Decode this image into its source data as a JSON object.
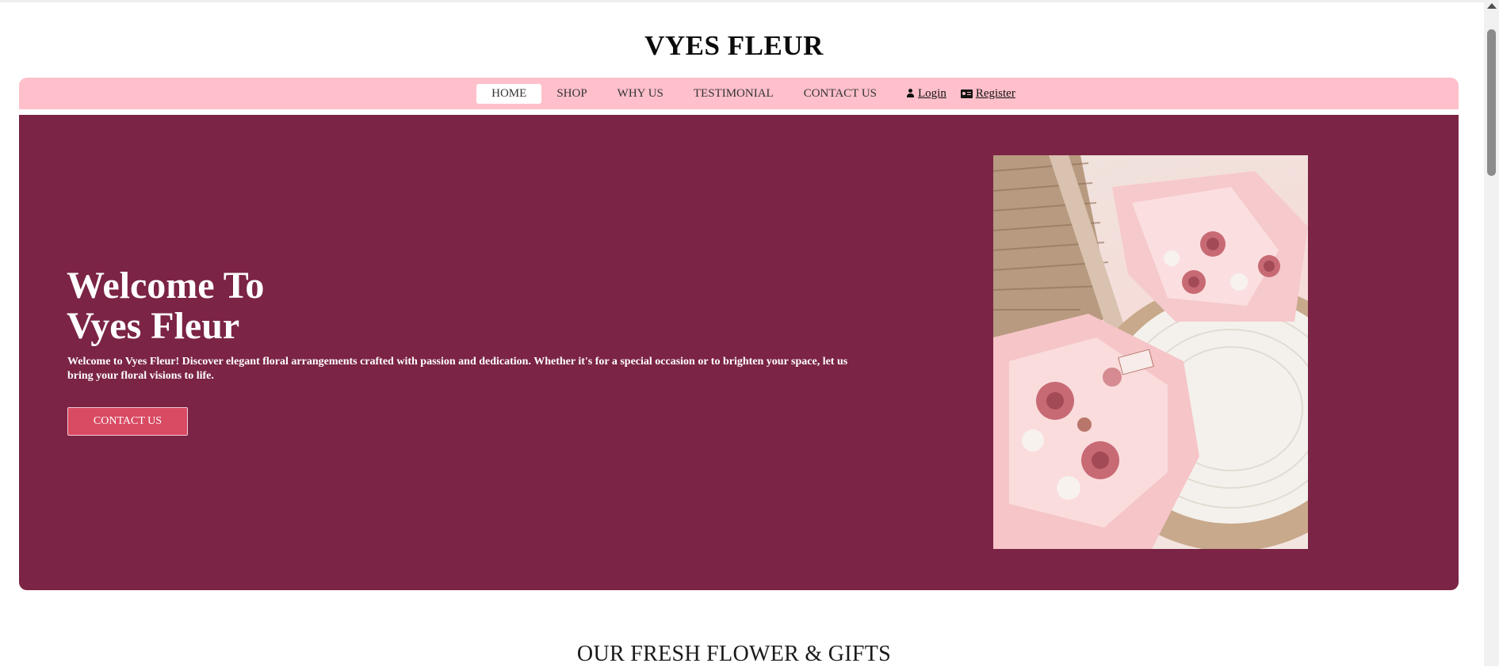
{
  "brand": {
    "title": "VYES FLEUR"
  },
  "nav": {
    "items": [
      {
        "label": "HOME",
        "active": true
      },
      {
        "label": "SHOP",
        "active": false
      },
      {
        "label": "WHY US",
        "active": false
      },
      {
        "label": "TESTIMONIAL",
        "active": false
      },
      {
        "label": "CONTACT US",
        "active": false
      }
    ],
    "login_label": "Login",
    "register_label": "Register",
    "login_icon": "user-icon",
    "register_icon": "id-card-icon"
  },
  "hero": {
    "title_line1": "Welcome To",
    "title_line2": "Vyes Fleur",
    "description": "Welcome to Vyes Fleur! Discover elegant floral arrangements crafted with passion and dedication. Whether it's for a special occasion or to brighten your space, let us bring your floral visions to life.",
    "button_label": "CONTACT US",
    "background_color": "#7b2445",
    "button_color": "#d94b63"
  },
  "section": {
    "title": "OUR FRESH FLOWER & GIFTS"
  },
  "colors": {
    "navbar": "#ffc0cb",
    "accent": "#7b2445"
  }
}
